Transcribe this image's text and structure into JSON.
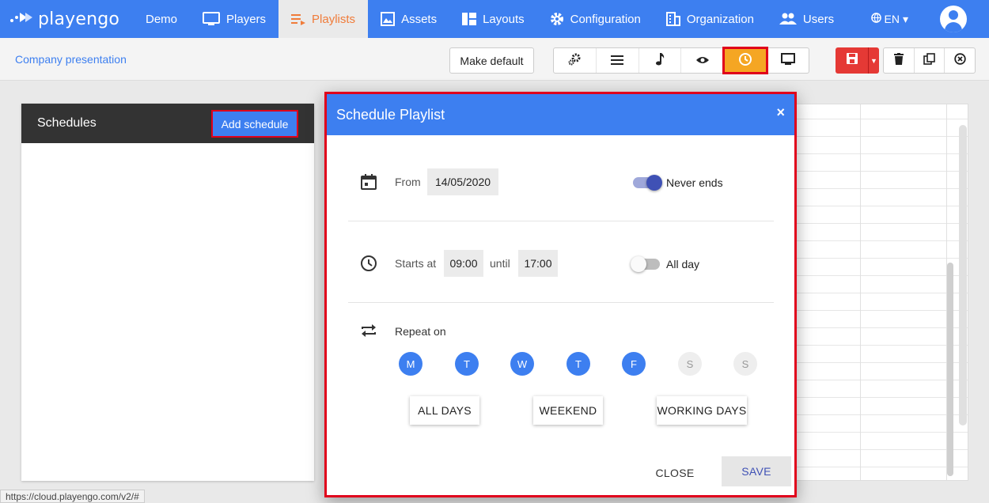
{
  "brand": {
    "name": "playengo"
  },
  "nav": {
    "items": [
      {
        "label": "Demo",
        "icon": "none"
      },
      {
        "label": "Players",
        "icon": "monitor-icon"
      },
      {
        "label": "Playlists",
        "icon": "playlist-icon"
      },
      {
        "label": "Assets",
        "icon": "image-icon"
      },
      {
        "label": "Layouts",
        "icon": "layout-icon"
      },
      {
        "label": "Configuration",
        "icon": "gear-icon"
      },
      {
        "label": "Organization",
        "icon": "building-icon"
      },
      {
        "label": "Users",
        "icon": "users-icon"
      }
    ],
    "active": "Playlists",
    "language": "EN"
  },
  "toolbar": {
    "playlist_title": "Company presentation",
    "make_default_label": "Make default"
  },
  "schedules": {
    "title": "Schedules",
    "add_label": "Add schedule"
  },
  "modal": {
    "title": "Schedule Playlist",
    "close_symbol": "×",
    "from_label": "From",
    "from_value": "14/05/2020",
    "never_ends_label": "Never ends",
    "never_ends_on": true,
    "starts_label": "Starts at",
    "start_time": "09:00",
    "until_label": "until",
    "end_time": "17:00",
    "all_day_label": "All day",
    "all_day_on": false,
    "repeat_label": "Repeat on",
    "days": [
      {
        "letter": "M",
        "on": true
      },
      {
        "letter": "T",
        "on": true
      },
      {
        "letter": "W",
        "on": true
      },
      {
        "letter": "T",
        "on": true
      },
      {
        "letter": "F",
        "on": true
      },
      {
        "letter": "S",
        "on": false
      },
      {
        "letter": "S",
        "on": false
      }
    ],
    "presets": [
      "ALL DAYS",
      "WEEKEND",
      "WORKING DAYS"
    ],
    "close_label": "CLOSE",
    "save_label": "SAVE"
  },
  "status_url": "https://cloud.playengo.com/v2/#",
  "colors": {
    "primary": "#3d7ff0",
    "accent": "#f5a623",
    "save": "#e53935",
    "highlight": "#e0001b"
  }
}
